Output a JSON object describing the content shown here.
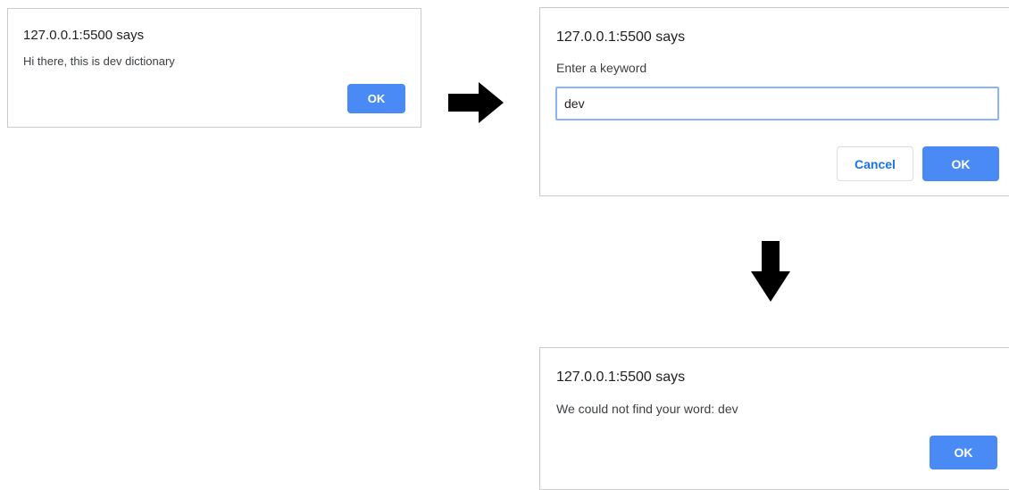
{
  "dialogs": {
    "alert_greeting": {
      "title": "127.0.0.1:5500 says",
      "message": "Hi there, this is dev dictionary",
      "ok_label": "OK"
    },
    "prompt_keyword": {
      "title": "127.0.0.1:5500 says",
      "message": "Enter a keyword",
      "input_value": "dev",
      "cancel_label": "Cancel",
      "ok_label": "OK"
    },
    "alert_not_found": {
      "title": "127.0.0.1:5500 says",
      "message": "We could not find your word: dev",
      "ok_label": "OK"
    }
  },
  "arrows": {
    "first": "arrow-right-icon",
    "second": "arrow-down-icon"
  },
  "colors": {
    "ok_button": "#4a8af4",
    "cancel_text": "#1a73e8",
    "input_border": "#8ab4f8",
    "dialog_border": "#c9c9c9",
    "arrow": "#000000"
  }
}
